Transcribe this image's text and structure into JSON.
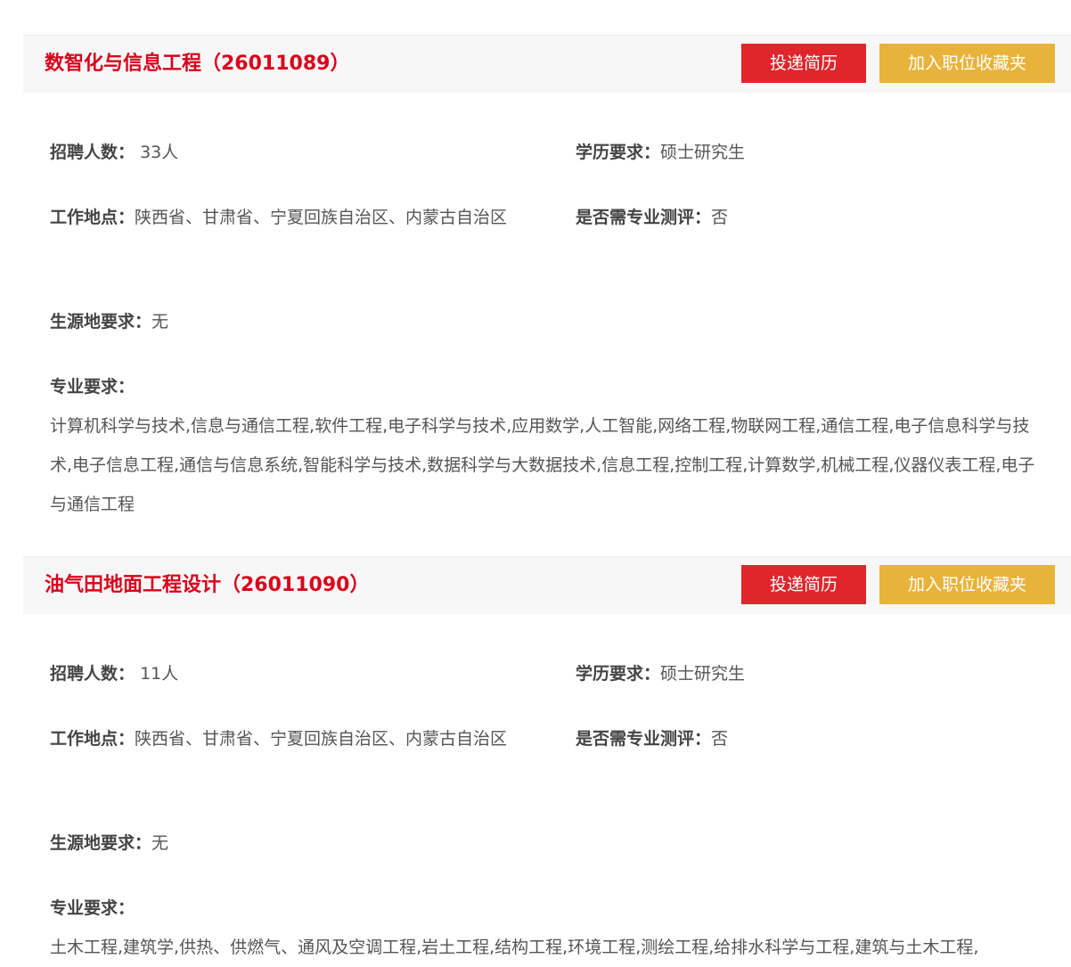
{
  "labels": {
    "count": "招聘人数：",
    "education": "学历要求：",
    "location": "工作地点：",
    "evaluation": "是否需专业测评：",
    "origin": "生源地要求：",
    "major": "专业要求："
  },
  "buttons": {
    "apply": "投递简历",
    "favorite": "加入职位收藏夹"
  },
  "jobs": [
    {
      "title": "数智化与信息工程（26011089）",
      "count": "33人",
      "education": "硕士研究生",
      "location": "陕西省、甘肃省、宁夏回族自治区、内蒙古自治区",
      "evaluation": "否",
      "origin": "无",
      "majors": "计算机科学与技术,信息与通信工程,软件工程,电子科学与技术,应用数学,人工智能,网络工程,物联网工程,通信工程,电子信息科学与技术,电子信息工程,通信与信息系统,智能科学与技术,数据科学与大数据技术,信息工程,控制工程,计算数学,机械工程,仪器仪表工程,电子与通信工程"
    },
    {
      "title": "油气田地面工程设计（26011090）",
      "count": "11人",
      "education": "硕士研究生",
      "location": "陕西省、甘肃省、宁夏回族自治区、内蒙古自治区",
      "evaluation": "否",
      "origin": "无",
      "majors": "土木工程,建筑学,供热、供燃气、通风及空调工程,岩土工程,结构工程,环境工程,测绘工程,给排水科学与工程,建筑与土木工程,"
    }
  ],
  "colors": {
    "title": "#d9001b",
    "apply_button": "#e0262b",
    "favorite_button": "#e8b33b",
    "header_bg": "#f7f7f7"
  }
}
